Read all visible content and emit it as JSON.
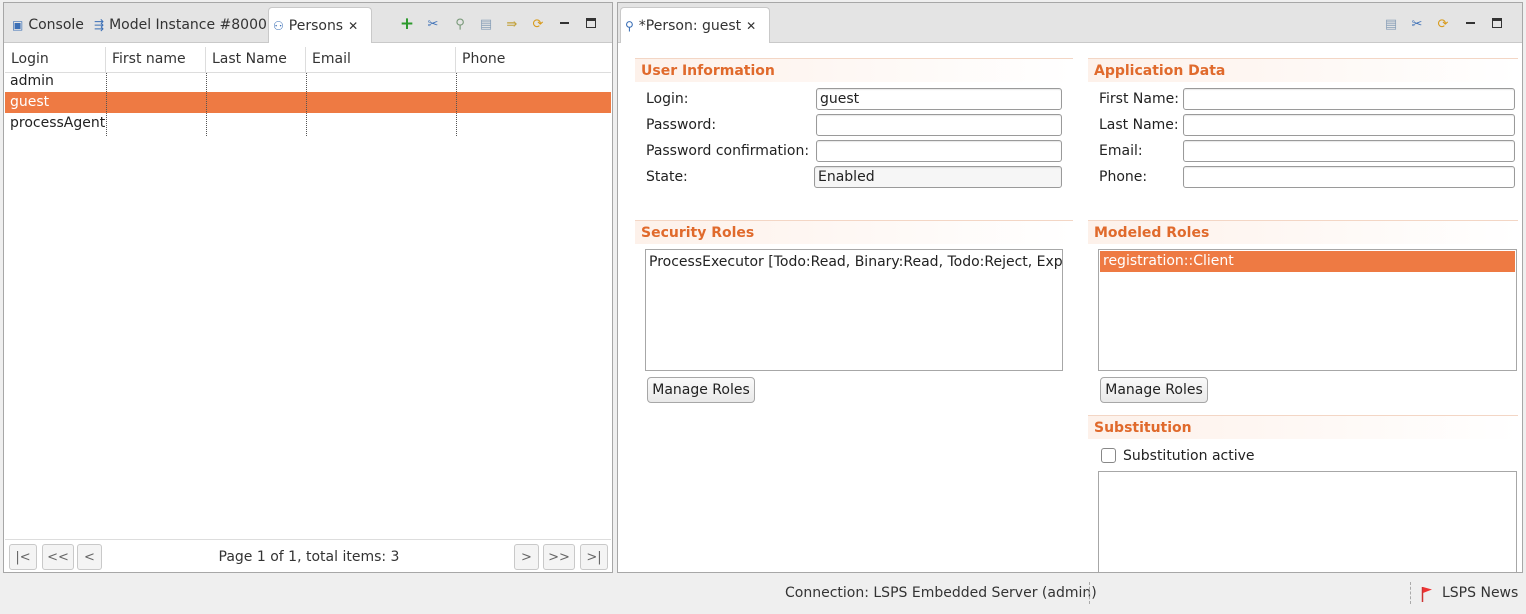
{
  "left_panel": {
    "tabs": [
      {
        "label": "Console",
        "icon": "console-icon"
      },
      {
        "label": "Model Instance #8000",
        "icon": "model-instance-icon"
      },
      {
        "label": "Persons",
        "icon": "persons-icon"
      }
    ],
    "columns": [
      "Login",
      "First name",
      "Last Name",
      "Email",
      "Phone"
    ],
    "rows": [
      {
        "login": "admin",
        "first": "",
        "last": "",
        "email": "",
        "phone": ""
      },
      {
        "login": "guest",
        "first": "",
        "last": "",
        "email": "",
        "phone": ""
      },
      {
        "login": "processAgent",
        "first": "",
        "last": "",
        "email": "",
        "phone": ""
      }
    ],
    "selected_row": 1,
    "pager": {
      "first": "|<",
      "prev_many": "<<",
      "prev": "<",
      "next": ">",
      "next_many": ">>",
      "last": ">|",
      "text": "Page 1 of 1, total items: 3"
    }
  },
  "editor": {
    "tab_label": "*Person: guest",
    "user_info": {
      "title": "User Information",
      "login_label": "Login:",
      "login_value": "guest",
      "password_label": "Password:",
      "password_value": "",
      "confirm_label": "Password confirmation:",
      "confirm_value": "",
      "state_label": "State:",
      "state_value": "Enabled"
    },
    "app_data": {
      "title": "Application Data",
      "first_label": "First Name:",
      "first_value": "",
      "last_label": "Last Name:",
      "last_value": "",
      "email_label": "Email:",
      "email_value": "",
      "phone_label": "Phone:",
      "phone_value": ""
    },
    "security_roles": {
      "title": "Security Roles",
      "items": [
        "ProcessExecutor [Todo:Read, Binary:Read, Todo:Reject, Expre"
      ],
      "button": "Manage Roles"
    },
    "modeled_roles": {
      "title": "Modeled Roles",
      "items": [
        "registration::Client"
      ],
      "button": "Manage Roles"
    },
    "substitution": {
      "title": "Substitution",
      "checkbox_label": "Substitution active",
      "checked": false
    }
  },
  "status_bar": {
    "connection": "Connection: LSPS Embedded Server (admin)",
    "news": "LSPS News"
  },
  "colors": {
    "selection": "#ee7a43",
    "section_title": "#e06a2c"
  }
}
